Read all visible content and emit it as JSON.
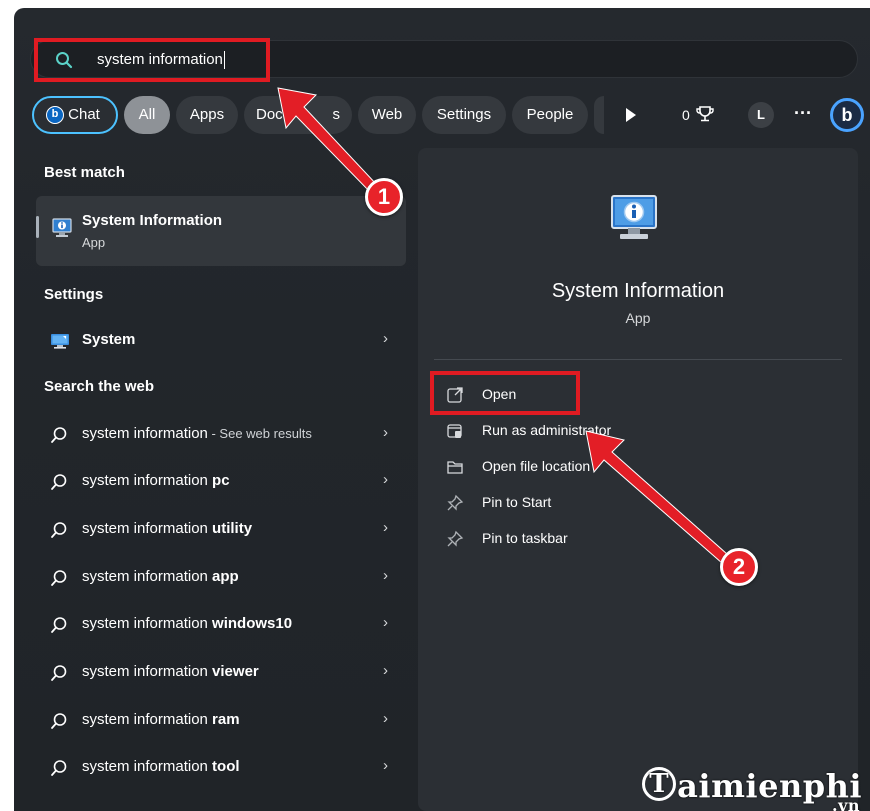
{
  "search": {
    "query": "system information"
  },
  "chips": {
    "chat": "Chat",
    "bing_letter": "b",
    "all": "All",
    "apps": "Apps",
    "documents_partial": "Docu",
    "documents_tail": "s",
    "web": "Web",
    "settings": "Settings",
    "people": "People",
    "points": "0",
    "avatar_letter": "L",
    "more": "···",
    "bing_button": "b"
  },
  "left": {
    "best_match_title": "Best match",
    "best_match": {
      "name": "System Information",
      "type": "App"
    },
    "settings_title": "Settings",
    "settings_item": "System",
    "web_title": "Search the web",
    "web_results": [
      {
        "prefix": "system information",
        "bold": "",
        "suffix": " - See web results"
      },
      {
        "prefix": "system information ",
        "bold": "pc",
        "suffix": ""
      },
      {
        "prefix": "system information ",
        "bold": "utility",
        "suffix": ""
      },
      {
        "prefix": "system information ",
        "bold": "app",
        "suffix": ""
      },
      {
        "prefix": "system information ",
        "bold": "windows10",
        "suffix": ""
      },
      {
        "prefix": "system information ",
        "bold": "viewer",
        "suffix": ""
      },
      {
        "prefix": "system information ",
        "bold": "ram",
        "suffix": ""
      },
      {
        "prefix": "system information ",
        "bold": "tool",
        "suffix": ""
      }
    ]
  },
  "right": {
    "title": "System Information",
    "subtitle": "App",
    "actions": [
      "Open",
      "Run as administrator",
      "Open file location",
      "Pin to Start",
      "Pin to taskbar"
    ]
  },
  "annotations": {
    "step1": "1",
    "step2": "2"
  },
  "watermark": {
    "main": "aimienphi",
    "initial": "T",
    "tld": ".vn"
  },
  "colors": {
    "accent": "#4cc2ff",
    "annotation_red": "#e01b22"
  }
}
